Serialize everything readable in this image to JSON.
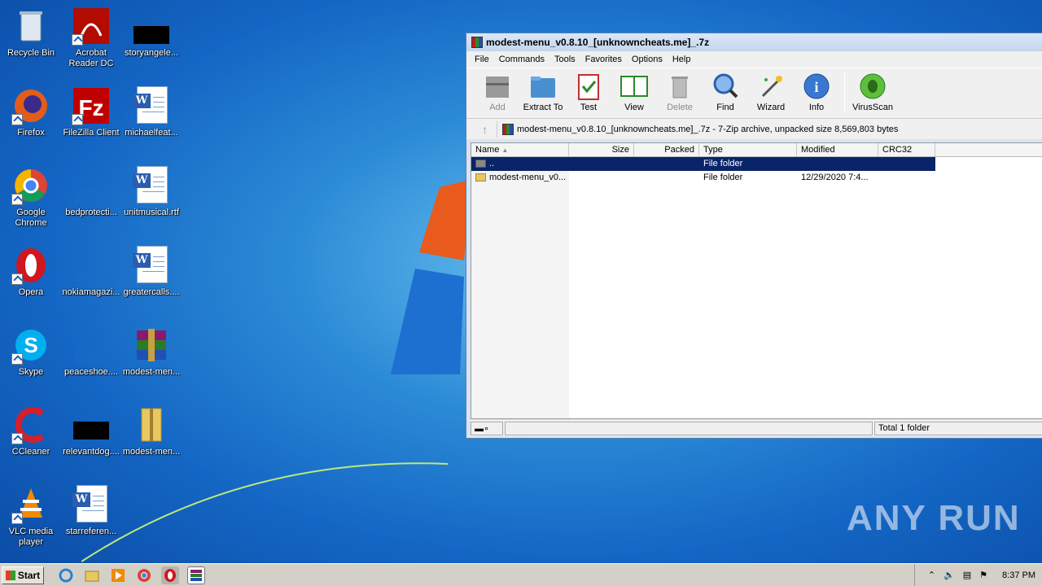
{
  "desktop": {
    "icons": [
      {
        "label": "Recycle Bin"
      },
      {
        "label": "Acrobat Reader DC"
      },
      {
        "label": "storyangele..."
      },
      {
        "label": "Firefox"
      },
      {
        "label": "FileZilla Client"
      },
      {
        "label": "michaelfeat..."
      },
      {
        "label": "Google Chrome"
      },
      {
        "label": "bedprotecti..."
      },
      {
        "label": "unitmusical.rtf"
      },
      {
        "label": "Opera"
      },
      {
        "label": "nokiamagazi..."
      },
      {
        "label": "greatercalls...."
      },
      {
        "label": "Skype"
      },
      {
        "label": "peaceshoe...."
      },
      {
        "label": "modest-men..."
      },
      {
        "label": "CCleaner"
      },
      {
        "label": "relevantdog...."
      },
      {
        "label": "modest-men..."
      },
      {
        "label": "VLC media player"
      },
      {
        "label": "starreferen..."
      }
    ]
  },
  "window": {
    "title": "modest-menu_v0.8.10_[unknowncheats.me]_.7z",
    "menu": [
      "File",
      "Commands",
      "Tools",
      "Favorites",
      "Options",
      "Help"
    ],
    "toolbar": {
      "add": "Add",
      "extract": "Extract To",
      "test": "Test",
      "view": "View",
      "delete": "Delete",
      "find": "Find",
      "wizard": "Wizard",
      "info": "Info",
      "virusscan": "VirusScan"
    },
    "address": "modest-menu_v0.8.10_[unknowncheats.me]_.7z - 7-Zip archive, unpacked size 8,569,803 bytes",
    "columns": [
      "Name",
      "Size",
      "Packed",
      "Type",
      "Modified",
      "CRC32"
    ],
    "rows": [
      {
        "name": "..",
        "size": "",
        "packed": "",
        "type": "File folder",
        "modified": "",
        "crc": ""
      },
      {
        "name": "modest-menu_v0...",
        "size": "",
        "packed": "",
        "type": "File folder",
        "modified": "12/29/2020 7:4...",
        "crc": ""
      }
    ],
    "status": "Total 1 folder"
  },
  "watermark": "ANY RUN",
  "taskbar": {
    "start": "Start",
    "clock": "8:37 PM"
  }
}
